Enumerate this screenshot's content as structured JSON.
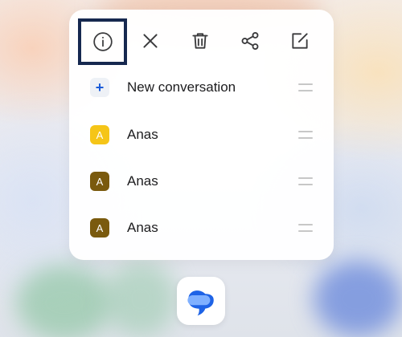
{
  "toolbar": {
    "icons": [
      "info-icon",
      "close-icon",
      "delete-icon",
      "share-icon",
      "edit-icon"
    ]
  },
  "menu": {
    "items": [
      {
        "avatar": "+",
        "label": "New conversation",
        "avatar_color": "#eef1f6"
      },
      {
        "avatar": "A",
        "label": "Anas",
        "avatar_color": "#f5c518"
      },
      {
        "avatar": "A",
        "label": "Anas",
        "avatar_color": "#7a5a0e"
      },
      {
        "avatar": "A",
        "label": "Anas",
        "avatar_color": "#7a5a0e"
      }
    ]
  },
  "dock": {
    "app_icon": "messages-bubble-icon"
  },
  "colors": {
    "highlight_border": "#16284f",
    "accent_blue": "#1a5bd8",
    "icon_gray": "#3a3a3c"
  }
}
